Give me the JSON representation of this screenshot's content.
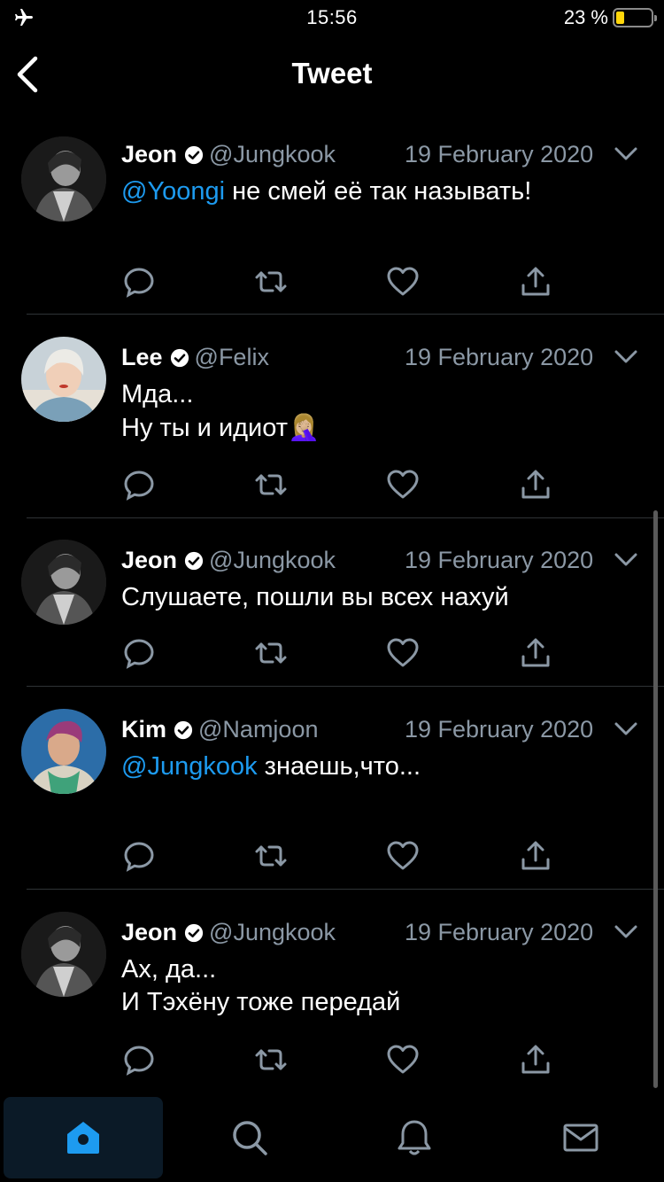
{
  "status_bar": {
    "time": "15:56",
    "battery_percent": "23 %",
    "battery_level": 0.23,
    "icons": [
      "airplane-icon",
      "battery-icon"
    ]
  },
  "header": {
    "title": "Tweet",
    "back_icon": "chevron-left-icon"
  },
  "colors": {
    "background": "#000000",
    "mention": "#1d9bf0",
    "secondary_text": "#8b98a5",
    "divider": "#2f3336",
    "active_tab": "#1d9bf0",
    "battery_fill": "#ffd60a"
  },
  "tweets": [
    {
      "name": "Jeon",
      "handle": "@Jungkook",
      "date": "19 February 2020",
      "mention": "@Yoongi",
      "text": " не смей её так называть!",
      "line2": "",
      "emoji": ""
    },
    {
      "name": "Lee",
      "handle": "@Felix",
      "date": "19 February 2020",
      "mention": "",
      "text": "Мда...",
      "line2": "Ну ты и идиот",
      "emoji": "🤦🏼‍♀️"
    },
    {
      "name": "Jeon",
      "handle": "@Jungkook",
      "date": "19 February 2020",
      "mention": "",
      "text": "Слушаете, пошли вы всех нахуй",
      "line2": "",
      "emoji": ""
    },
    {
      "name": "Kim",
      "handle": "@Namjoon",
      "date": "19 February 2020",
      "mention": "@Jungkook",
      "text": " знаешь,что...",
      "line2": "",
      "emoji": ""
    },
    {
      "name": "Jeon",
      "handle": "@Jungkook",
      "date": "19 February 2020",
      "mention": "",
      "text": "Ах, да...",
      "line2": "И Тэхёну тоже передай",
      "emoji": ""
    }
  ],
  "action_icons": [
    "reply-icon",
    "retweet-icon",
    "like-icon",
    "share-icon"
  ],
  "tab_bar": {
    "tabs": [
      "home-icon",
      "search-icon",
      "notifications-icon",
      "messages-icon"
    ],
    "active": "home-icon"
  }
}
